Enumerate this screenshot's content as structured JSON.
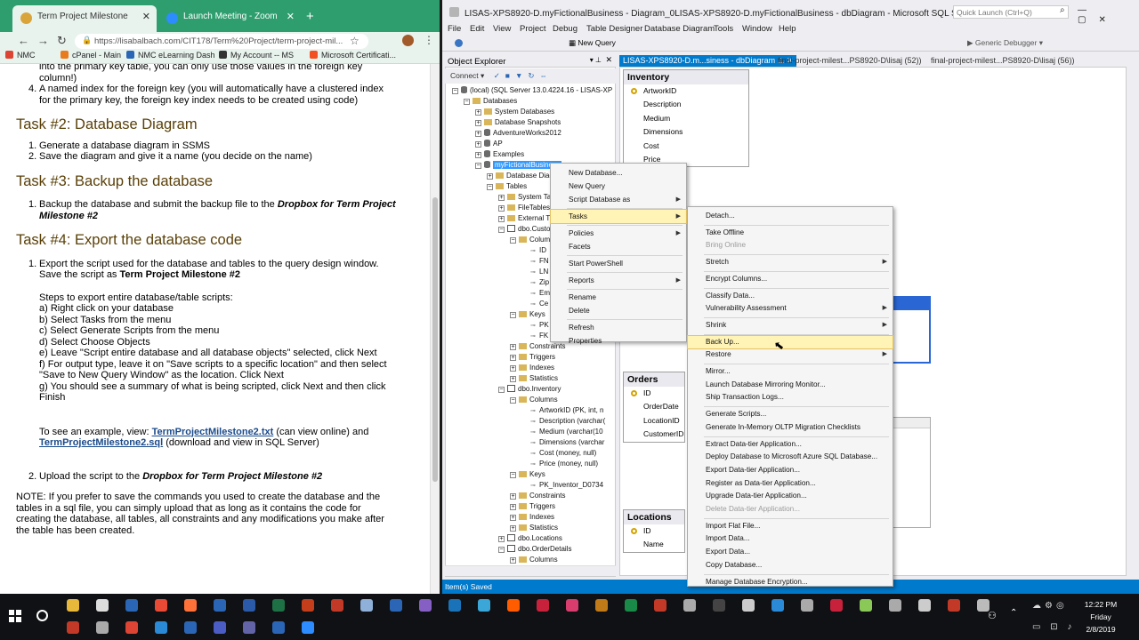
{
  "chrome": {
    "tabs": [
      {
        "title": "Term Project Milestone"
      },
      {
        "title": "Launch Meeting - Zoom"
      }
    ],
    "url": "https://lisabalbach.com/CIT178/Term%20Project/term-project-mil...",
    "bookmarks": [
      "NMC",
      "cPanel - Main",
      "NMC eLearning Dash",
      "My Account -- MSDN",
      "Microsoft Certificati..."
    ]
  },
  "document": {
    "intro_lines": [
      "into the primary key table, you can only use those values in the foreign key",
      "column!)"
    ],
    "item4_num": "4.",
    "item4_lines": [
      "A named index for the foreign key  (you will automatically have a clustered index",
      "for the primary key, the foreign key index needs to be created using code)"
    ],
    "task2_title": "Task #2:  Database Diagram",
    "task2_items": [
      {
        "num": "1.",
        "text": "Generate a database diagram in SSMS"
      },
      {
        "num": "2.",
        "text": "Save the diagram and give it a name (you decide on the name)"
      }
    ],
    "task3_title": "Task #3:  Backup the database",
    "task3_num": "1.",
    "task3_prefix": "Backup the database and submit the backup file to the ",
    "task3_bold": "Dropbox for Term Project",
    "task3_bold2": "Milestone #2",
    "task4_title": "Task #4:  Export the database code",
    "task4_num1": "1.",
    "task4_l1": "Export the script used for the database and tables to the query design window.",
    "task4_l2_prefix": "Save the script as ",
    "task4_l2_bold": "Term Project Milestone #2",
    "steps_title": "Steps to export entire database/table scripts:",
    "steps": [
      "a)  Right click on your database",
      "b)  Select Tasks from the menu",
      "c)  Select Generate Scripts from the menu",
      "d)  Select Choose Objects",
      "e)  Leave \"Script entire database and all database objects\" selected, click Next",
      "f)  For output type, leave it on \"Save scripts to a specific location\" and then select",
      "\"Save to New Query Window\" as the location.  Click Next",
      "g)   You should see a summary of what is being scripted, click Next and then click",
      "Finish"
    ],
    "example_prefix": "To see an example, view:  ",
    "example_link1": "TermProjectMilestone2.txt",
    "example_mid": "  (can view online) and",
    "example_link2": "TermProjectMilestone2.sql",
    "example_suffix": "  (download and view in SQL Server)",
    "upload_num": "2.",
    "upload_prefix": "Upload the script to the ",
    "upload_bold": "Dropbox for Term Project Milestone #2",
    "note_lines": [
      "NOTE:  If you prefer to save the commands you used to create the database and the",
      "tables in a sql file, you can simply upload that as long as it contains the code for",
      "creating the database, all tables, all constraints and any modifications you make after",
      "the table has been created."
    ]
  },
  "ssms": {
    "title": "LISAS-XPS8920-D.myFictionalBusiness - Diagram_0LISAS-XPS8920-D.myFictionalBusiness - dbDiagram - Microsoft SQL Server Management Studio",
    "quick_launch": "Quick Launch (Ctrl+Q)",
    "menu": [
      "File",
      "Edit",
      "View",
      "Project",
      "Debug",
      "Table Designer",
      "Database Diagram",
      "Tools",
      "Window",
      "Help"
    ],
    "toolbar": {
      "new_query": "New Query",
      "debugger": "Generic Debugger"
    },
    "object_explorer": {
      "title": "Object Explorer",
      "connect": "Connect"
    },
    "tree": [
      {
        "text": "(local) (SQL Server 13.0.4224.16 - LISAS-XP",
        "kind": "server",
        "d": 0,
        "pm": "-"
      },
      {
        "text": "Databases",
        "kind": "folder",
        "d": 1,
        "pm": "-"
      },
      {
        "text": "System Databases",
        "kind": "folder",
        "d": 2,
        "pm": "+"
      },
      {
        "text": "Database Snapshots",
        "kind": "folder",
        "d": 2,
        "pm": "+"
      },
      {
        "text": "AdventureWorks2012",
        "kind": "db",
        "d": 2,
        "pm": "+"
      },
      {
        "text": "AP",
        "kind": "db",
        "d": 2,
        "pm": "+"
      },
      {
        "text": "Examples",
        "kind": "db",
        "d": 2,
        "pm": "+"
      },
      {
        "text": "myFictionalBusiness",
        "kind": "db",
        "d": 2,
        "pm": "-",
        "sel": true
      },
      {
        "text": "Database Diag",
        "kind": "folder",
        "d": 3,
        "pm": "+"
      },
      {
        "text": "Tables",
        "kind": "folder",
        "d": 3,
        "pm": "-"
      },
      {
        "text": "System Ta",
        "kind": "folder",
        "d": 4,
        "pm": "+"
      },
      {
        "text": "FileTables",
        "kind": "folder",
        "d": 4,
        "pm": "+"
      },
      {
        "text": "External T",
        "kind": "folder",
        "d": 4,
        "pm": "+"
      },
      {
        "text": "dbo.Custo",
        "kind": "table",
        "d": 4,
        "pm": "-"
      },
      {
        "text": "Colum",
        "kind": "folder",
        "d": 5,
        "pm": "-"
      },
      {
        "text": "ID",
        "kind": "col",
        "d": 6
      },
      {
        "text": "FN",
        "kind": "col",
        "d": 6
      },
      {
        "text": "LN",
        "kind": "col",
        "d": 6
      },
      {
        "text": "Zip",
        "kind": "col",
        "d": 6
      },
      {
        "text": "Em",
        "kind": "col",
        "d": 6
      },
      {
        "text": "Ce",
        "kind": "col",
        "d": 6
      },
      {
        "text": "Keys",
        "kind": "folder",
        "d": 5,
        "pm": "-"
      },
      {
        "text": "PK",
        "kind": "col",
        "d": 6
      },
      {
        "text": "FK",
        "kind": "col",
        "d": 6
      },
      {
        "text": "Constraints",
        "kind": "folder",
        "d": 5,
        "pm": "+"
      },
      {
        "text": "Triggers",
        "kind": "folder",
        "d": 5,
        "pm": "+"
      },
      {
        "text": "Indexes",
        "kind": "folder",
        "d": 5,
        "pm": "+"
      },
      {
        "text": "Statistics",
        "kind": "folder",
        "d": 5,
        "pm": "+"
      },
      {
        "text": "dbo.Inventory",
        "kind": "table",
        "d": 4,
        "pm": "-"
      },
      {
        "text": "Columns",
        "kind": "folder",
        "d": 5,
        "pm": "-"
      },
      {
        "text": "ArtworkID (PK, int, n",
        "kind": "col",
        "d": 6
      },
      {
        "text": "Description (varchar(",
        "kind": "col",
        "d": 6
      },
      {
        "text": "Medium (varchar(10",
        "kind": "col",
        "d": 6
      },
      {
        "text": "Dimensions (varchar",
        "kind": "col",
        "d": 6
      },
      {
        "text": "Cost (money, null)",
        "kind": "col",
        "d": 6
      },
      {
        "text": "Price (money, null)",
        "kind": "col",
        "d": 6
      },
      {
        "text": "Keys",
        "kind": "folder",
        "d": 5,
        "pm": "-"
      },
      {
        "text": "PK_Inventor_D0734",
        "kind": "col",
        "d": 6
      },
      {
        "text": "Constraints",
        "kind": "folder",
        "d": 5,
        "pm": "+"
      },
      {
        "text": "Triggers",
        "kind": "folder",
        "d": 5,
        "pm": "+"
      },
      {
        "text": "Indexes",
        "kind": "folder",
        "d": 5,
        "pm": "+"
      },
      {
        "text": "Statistics",
        "kind": "folder",
        "d": 5,
        "pm": "+"
      },
      {
        "text": "dbo.Locations",
        "kind": "table",
        "d": 4,
        "pm": "+"
      },
      {
        "text": "dbo.OrderDetails",
        "kind": "table",
        "d": 4,
        "pm": "-"
      },
      {
        "text": "Columns",
        "kind": "folder",
        "d": 5,
        "pm": "+"
      }
    ],
    "doc_tabs": [
      "LISAS-XPS8920-D.m...siness - dbDiagram",
      "final-project-milest...PS8920-D\\lisaj (52))",
      "final-project-milest...PS8920-D\\lisaj (56))"
    ],
    "diagram_tables": [
      {
        "name": "Inventory",
        "cols": [
          "ArtworkID",
          "Description",
          "Medium",
          "Dimensions",
          "Cost",
          "Price"
        ],
        "key": 0
      },
      {
        "name": "Orders",
        "cols": [
          "ID",
          "OrderDate",
          "LocationID",
          "CustomerID"
        ],
        "key": 0
      },
      {
        "name": "Locations",
        "cols": [
          "ID",
          "Name"
        ],
        "key": 0
      }
    ],
    "context_menu_1": [
      {
        "label": "New Database..."
      },
      {
        "label": "New Query"
      },
      {
        "label": "Script Database as",
        "sub": true
      },
      {
        "sep": true
      },
      {
        "label": "Tasks",
        "sub": true,
        "hl": true
      },
      {
        "sep": true
      },
      {
        "label": "Policies",
        "sub": true
      },
      {
        "label": "Facets"
      },
      {
        "sep": true
      },
      {
        "label": "Start PowerShell"
      },
      {
        "sep": true
      },
      {
        "label": "Reports",
        "sub": true
      },
      {
        "sep": true
      },
      {
        "label": "Rename"
      },
      {
        "label": "Delete"
      },
      {
        "sep": true
      },
      {
        "label": "Refresh"
      },
      {
        "label": "Properties"
      }
    ],
    "context_menu_2": [
      {
        "label": "Detach..."
      },
      {
        "sep": true
      },
      {
        "label": "Take Offline"
      },
      {
        "label": "Bring Online",
        "dis": true
      },
      {
        "sep": true
      },
      {
        "label": "Stretch",
        "sub": true
      },
      {
        "sep": true
      },
      {
        "label": "Encrypt Columns..."
      },
      {
        "sep": true
      },
      {
        "label": "Classify Data..."
      },
      {
        "label": "Vulnerability Assessment",
        "sub": true
      },
      {
        "sep": true
      },
      {
        "label": "Shrink",
        "sub": true
      },
      {
        "sep": true
      },
      {
        "label": "Back Up...",
        "hl": true
      },
      {
        "label": "Restore",
        "sub": true
      },
      {
        "sep": true
      },
      {
        "label": "Mirror..."
      },
      {
        "label": "Launch Database Mirroring Monitor..."
      },
      {
        "label": "Ship Transaction Logs..."
      },
      {
        "sep": true
      },
      {
        "label": "Generate Scripts..."
      },
      {
        "label": "Generate In-Memory OLTP Migration Checklists"
      },
      {
        "sep": true
      },
      {
        "label": "Extract Data-tier Application..."
      },
      {
        "label": "Deploy Database to Microsoft Azure SQL Database..."
      },
      {
        "label": "Export Data-tier Application..."
      },
      {
        "label": "Register as Data-tier Application..."
      },
      {
        "label": "Upgrade Data-tier Application..."
      },
      {
        "label": "Delete Data-tier Application...",
        "dis": true
      },
      {
        "sep": true
      },
      {
        "label": "Import Flat File..."
      },
      {
        "label": "Import Data..."
      },
      {
        "label": "Export Data..."
      },
      {
        "label": "Copy Database..."
      },
      {
        "sep": true
      },
      {
        "label": "Manage Database Encryption..."
      }
    ],
    "status": "Item(s) Saved"
  },
  "taskbar": {
    "time": "12:22 PM",
    "day": "Friday",
    "date": "2/8/2019"
  },
  "colors": {
    "chrome_green": "#2f9e6e",
    "ssms_blue": "#007acc",
    "menu_highlight": "#fff3b5",
    "heading": "#5a4008"
  }
}
